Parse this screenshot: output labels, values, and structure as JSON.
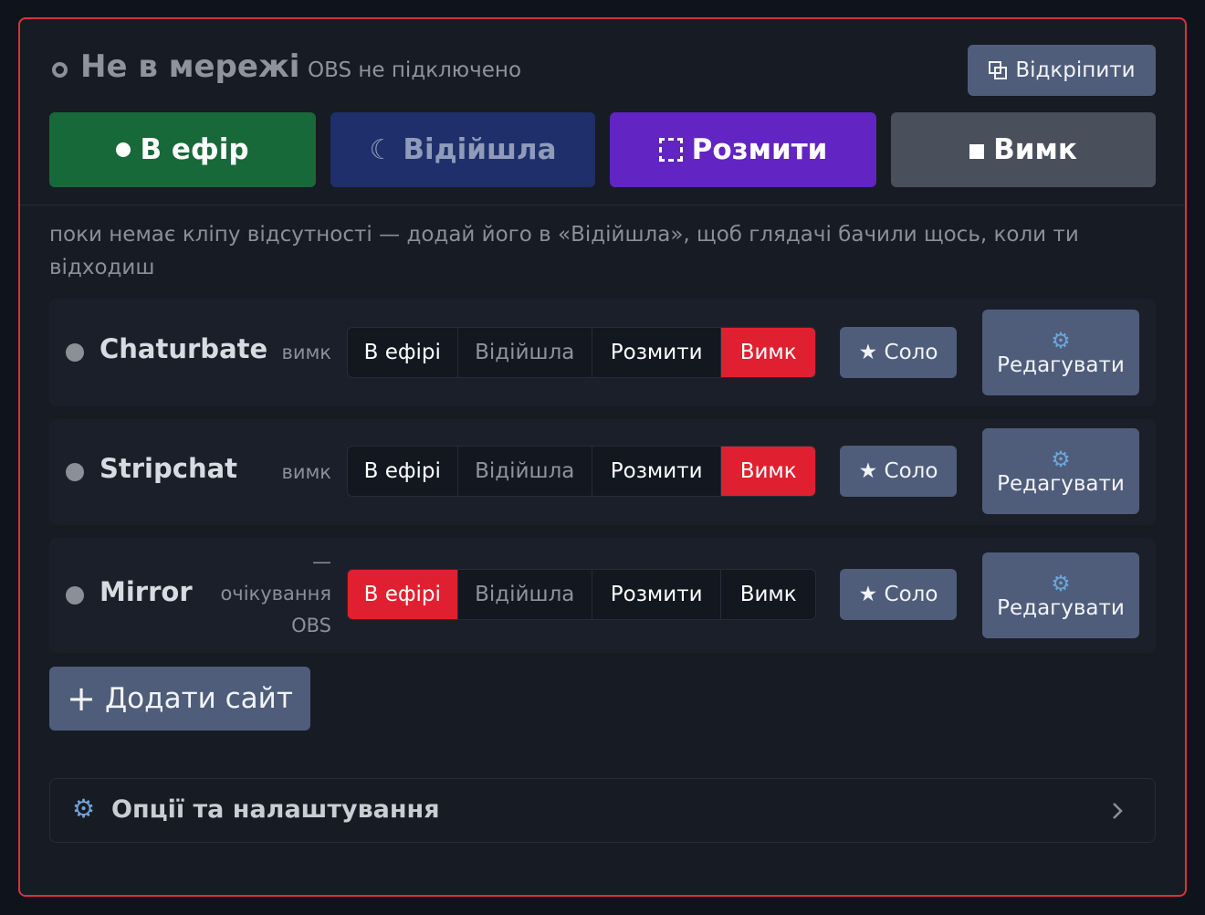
{
  "header": {
    "status_title": "Не в мережі",
    "status_sub": "OBS не підключено",
    "undock_label": "Відкріпити"
  },
  "modes": {
    "live": "В ефір",
    "away": "Відійшла",
    "blur": "Розмити",
    "off": "Вимк"
  },
  "notice": "поки немає кліпу відсутності — додай його в «Відійшла», щоб глядачі бачили щось, коли ти відходиш",
  "segment_labels": {
    "live": "В ефірі",
    "away": "Відійшла",
    "blur": "Розмити",
    "off": "Вимк"
  },
  "sites": [
    {
      "name": "Chaturbate",
      "state": "вимк",
      "active": "off"
    },
    {
      "name": "Stripchat",
      "state": "вимк",
      "active": "off"
    },
    {
      "name": "Mirror",
      "state": "— очікування OBS",
      "active": "live"
    }
  ],
  "solo_label": "★ Соло",
  "edit_label": "Редагувати",
  "add_site_label": "Додати сайт",
  "options_label": "Опції та налаштування",
  "colors": {
    "panel_border": "#d9323b",
    "live": "#17693a",
    "away": "#1e2f6c",
    "blur": "#6224c2",
    "off": "#4a505b",
    "active_segment": "#e02030",
    "secondary_button": "#4f5d7a"
  },
  "icons": {
    "status": "hollow-circle-icon",
    "undock": "undock-windows-icon",
    "live": "filled-dot-icon",
    "away": "moon-icon",
    "blur": "dashed-square-icon",
    "off": "stop-square-icon",
    "edit": "gear-icon",
    "add": "plus-icon",
    "options": "gear-icon",
    "expand": "chevron-right-icon"
  }
}
